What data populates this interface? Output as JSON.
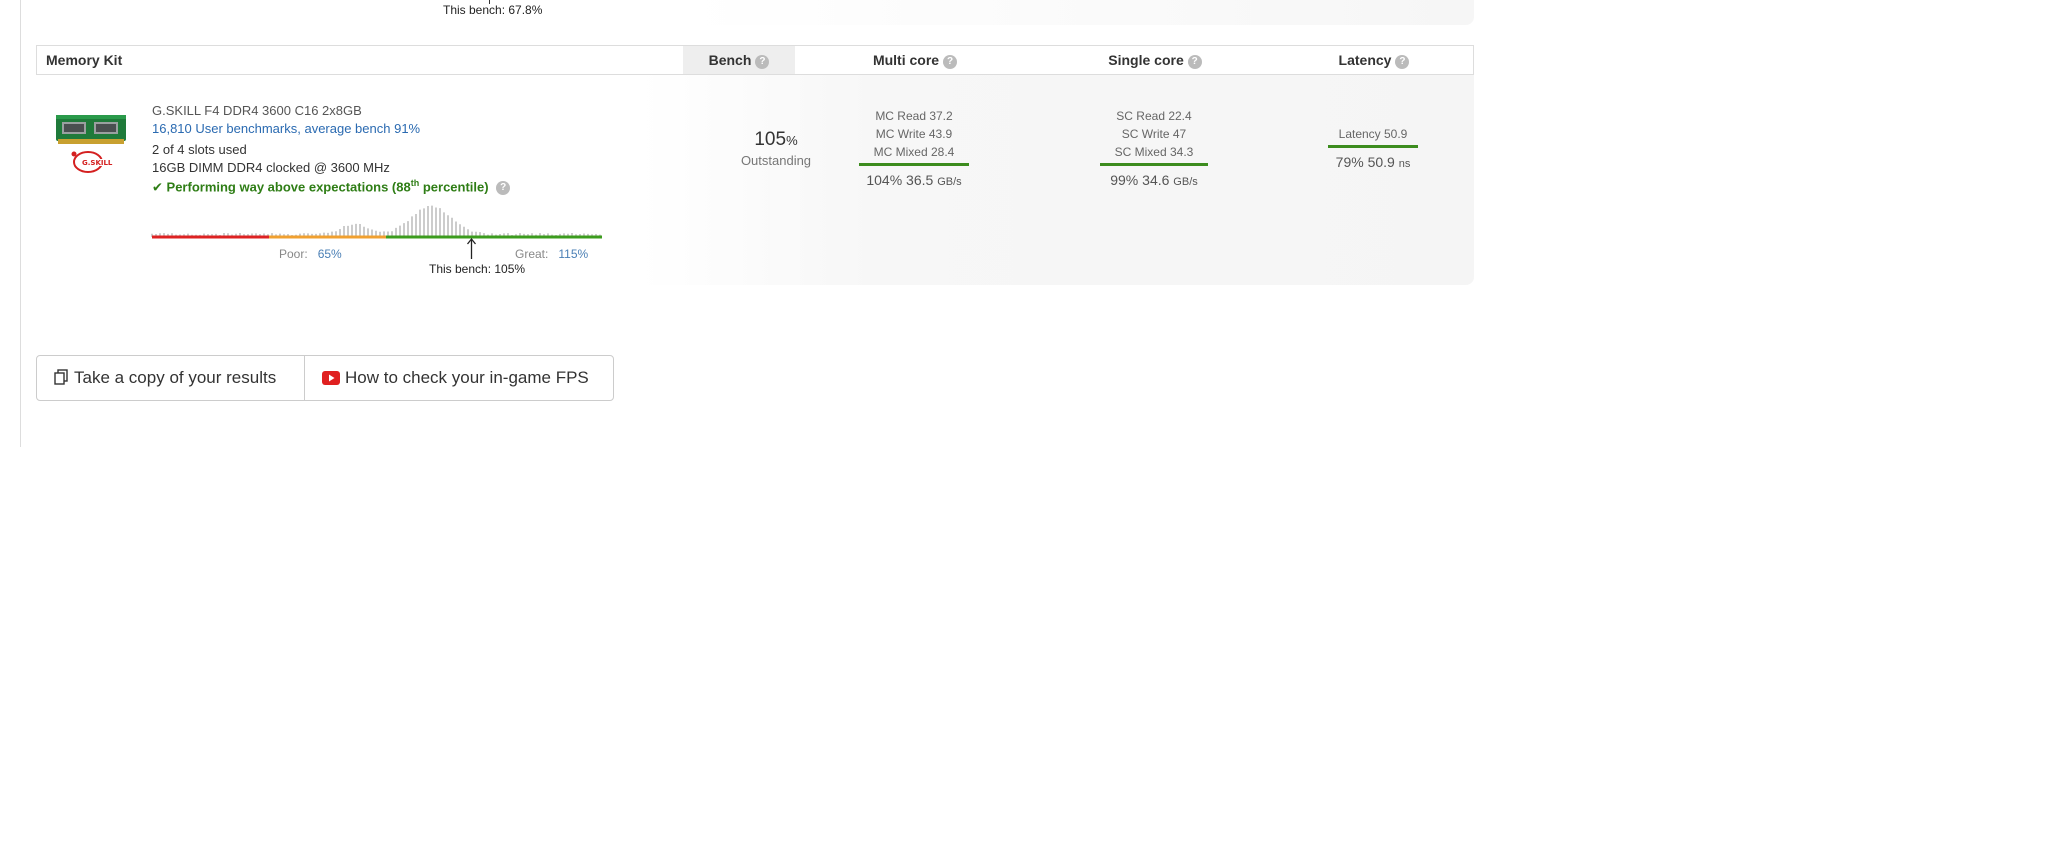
{
  "previous": {
    "bench_text": "This bench: 67.8%"
  },
  "table": {
    "headers": {
      "memory_kit": "Memory Kit",
      "bench": "Bench",
      "multi_core": "Multi core",
      "single_core": "Single core",
      "latency": "Latency"
    },
    "help_glyph": "?",
    "row": {
      "name": "G.SKILL F4 DDR4 3600 C16 2x8GB",
      "benchmarks_link": "16,810 User benchmarks, average bench 91%",
      "slots": "2 of 4 slots used",
      "spec": "16GB DIMM DDR4 clocked @ 3600 MHz",
      "performance_prefix": "Performing way above expectations (88",
      "performance_sup": "th",
      "performance_suffix": " percentile)",
      "performance_percentile": 88,
      "check_glyph": "✔",
      "distribution": {
        "poor_label": "Poor:",
        "poor_value": "65%",
        "great_label": "Great:",
        "great_value": "115%",
        "this_bench": "This bench: 105%",
        "bench_position": 0.71,
        "poor_position": 0.26,
        "great_position": 0.52,
        "bar_colors": {
          "poor": "#dd2222",
          "mid": "#f0a030",
          "good": "#3c9c1e"
        }
      },
      "bench": {
        "value": "105",
        "unit": "%",
        "rating": "Outstanding"
      },
      "multi_core": {
        "lines": [
          "MC Read 37.2",
          "MC Write 43.9",
          "MC Mixed 28.4"
        ],
        "pct": "104%",
        "value": "36.5",
        "unit": "GB/s"
      },
      "single_core": {
        "lines": [
          "SC Read 22.4",
          "SC Write 47",
          "SC Mixed 34.3"
        ],
        "pct": "99%",
        "value": "34.6",
        "unit": "GB/s"
      },
      "latency": {
        "lines": [
          "Latency 50.9"
        ],
        "pct": "79%",
        "value": "50.9",
        "unit": "ns"
      }
    }
  },
  "buttons": {
    "copy_results": "Take a copy of your results",
    "check_fps": "How to check your in-game FPS"
  },
  "colors": {
    "link": "#2a6ab1",
    "success": "#2e7d15",
    "bar_green": "#3c8c1e",
    "youtube_red": "#e02020"
  }
}
